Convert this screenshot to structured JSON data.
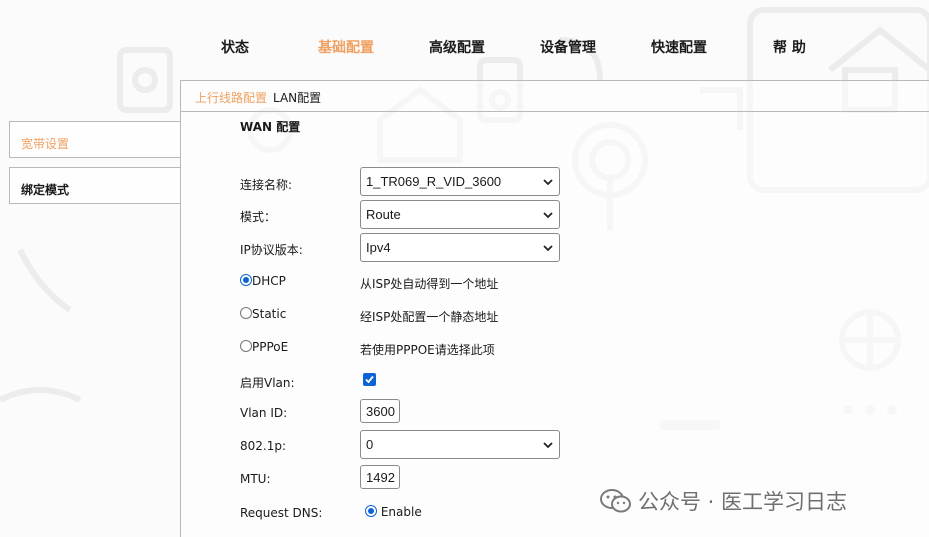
{
  "topnav": {
    "items": [
      {
        "label": "状态"
      },
      {
        "label": "基础配置"
      },
      {
        "label": "高级配置"
      },
      {
        "label": "设备管理"
      },
      {
        "label": "快速配置"
      },
      {
        "label": "帮 助"
      }
    ],
    "active": "基础配置"
  },
  "subnav": {
    "items": [
      {
        "label": "上行线路配置"
      },
      {
        "label": "LAN配置"
      }
    ],
    "active": "上行线路配置"
  },
  "sidebar": {
    "items": [
      {
        "label": "宽带设置"
      },
      {
        "label": "绑定模式"
      }
    ],
    "active": "宽带设置"
  },
  "form": {
    "section_title": "WAN 配置",
    "connection_name": {
      "label": "连接名称:",
      "value": "1_TR069_R_VID_3600"
    },
    "mode": {
      "label": "模式：",
      "value": "Route"
    },
    "ip_version": {
      "label": "IP协议版本:",
      "value": "Ipv4"
    },
    "radios": [
      {
        "label": "DHCP",
        "desc": "从ISP处自动得到一个地址",
        "selected": true
      },
      {
        "label": "Static",
        "desc": "经ISP处配置一个静态地址",
        "selected": false
      },
      {
        "label": "PPPoE",
        "desc": "若使用PPPOE请选择此项",
        "selected": false
      }
    ],
    "enable_vlan": {
      "label": "启用Vlan:",
      "checked": true
    },
    "vlan_id": {
      "label": "Vlan ID:",
      "value": "3600"
    },
    "dot1p": {
      "label": "802.1p:",
      "value": "0"
    },
    "mtu": {
      "label": "MTU:",
      "value": "1492"
    },
    "request_dns": {
      "label": "Request DNS:",
      "option": "Enable",
      "selected": true
    }
  },
  "watermark": {
    "text": "公众号 · 医工学习日志",
    "icon": "wechat-icon"
  },
  "colors": {
    "accent": "#f0a060",
    "checkbox": "#0b63d6"
  }
}
